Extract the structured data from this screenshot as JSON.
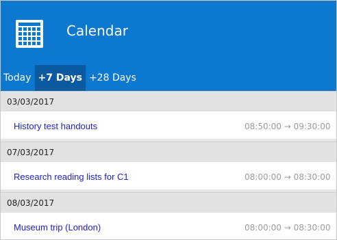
{
  "header": {
    "title": "Calendar",
    "icon": "calendar-icon",
    "background_color": "#0c78d0",
    "active_tab_color": "#0b5aa0"
  },
  "tabs": [
    {
      "label": "Today",
      "active": false
    },
    {
      "label": "+7 Days",
      "active": true
    },
    {
      "label": "+28 Days",
      "active": false
    }
  ],
  "groups": [
    {
      "date": "03/03/2017",
      "event": {
        "name": "History test handouts",
        "time": "08:50:00 → 09:30:00"
      }
    },
    {
      "date": "07/03/2017",
      "event": {
        "name": "Research reading lists for C1",
        "time": "08:00:00 → 08:30:00"
      }
    },
    {
      "date": "08/03/2017",
      "event": {
        "name": "Museum trip (London)",
        "time": "08:00:00 → 08:30:00"
      }
    }
  ]
}
